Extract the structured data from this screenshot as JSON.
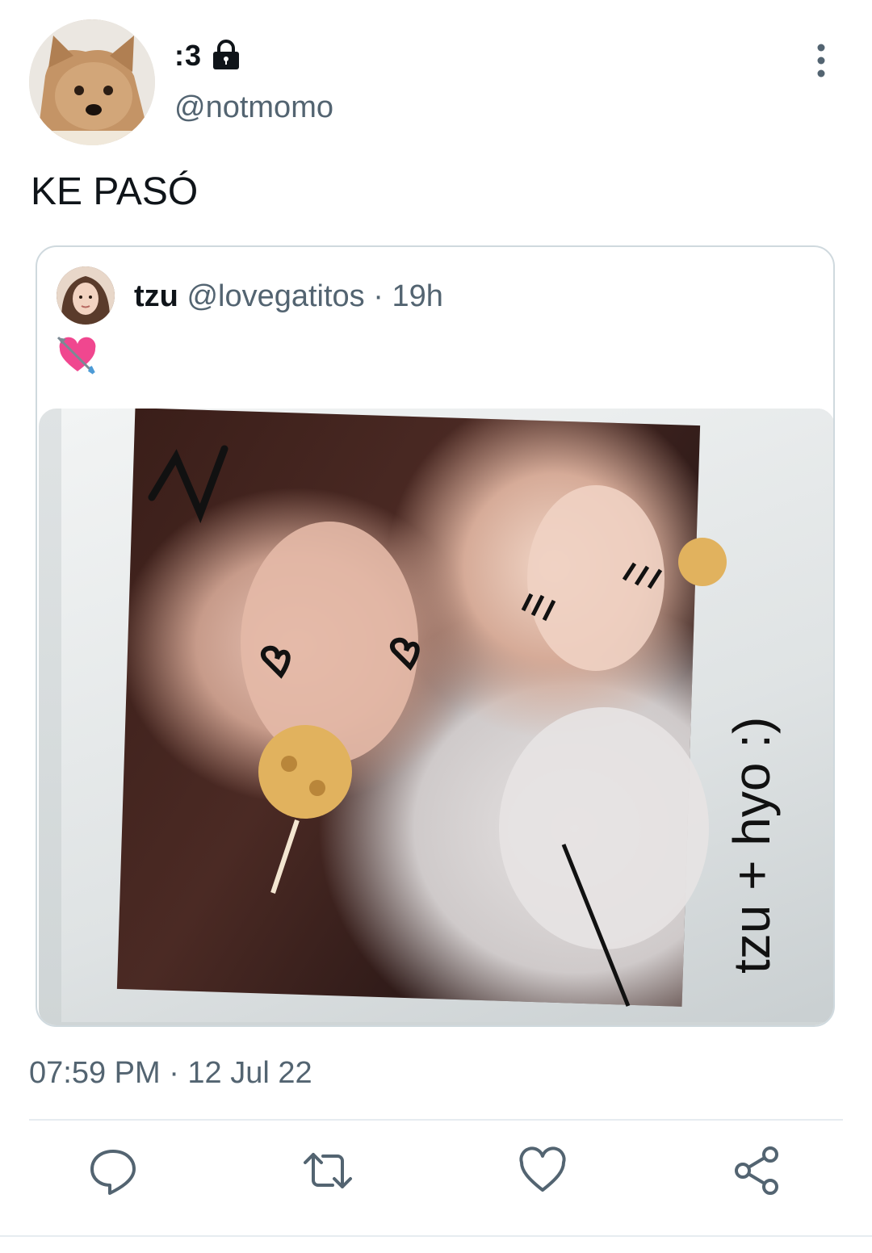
{
  "tweet": {
    "author": {
      "display_name": ":3",
      "handle": "@notmomo",
      "avatar_icon": "dog-avatar",
      "protected_icon": "lock-icon"
    },
    "text": "KE PASÓ",
    "timestamp": "07:59 PM · 12 Jul 22",
    "more_icon": "more-vertical-icon"
  },
  "quoted_tweet": {
    "author": {
      "display_name": "tzu",
      "handle": "@lovegatitos",
      "avatar_icon": "profile-avatar"
    },
    "time": "· 19h",
    "text_emoji": "heart-with-arrow-emoji",
    "photo": {
      "handwriting": "tzu + hyo :)",
      "description_icon": "polaroid-photo"
    }
  },
  "actions": [
    {
      "name": "reply",
      "icon": "reply-icon"
    },
    {
      "name": "retweet",
      "icon": "retweet-icon"
    },
    {
      "name": "like",
      "icon": "heart-icon"
    },
    {
      "name": "share",
      "icon": "share-icon"
    }
  ],
  "colors": {
    "text_primary": "#0f1419",
    "text_secondary": "#536471",
    "border": "#cfd9de"
  }
}
